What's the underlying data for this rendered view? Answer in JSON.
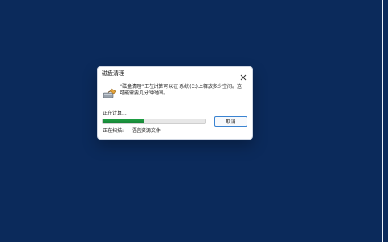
{
  "dialog": {
    "title": "磁盘清理",
    "message": "“磁盘清理”正在计算可以在 系统(C:)上释放多少空间。这可能需要几分钟时间。",
    "status_text": "正在计算...",
    "progress_percent": 40,
    "cancel_label": "取消",
    "scanning_label": "正在扫描:",
    "scanning_value": "语言资源文件"
  },
  "icons": {
    "close": "close-icon",
    "app": "disk-cleanup-icon"
  }
}
